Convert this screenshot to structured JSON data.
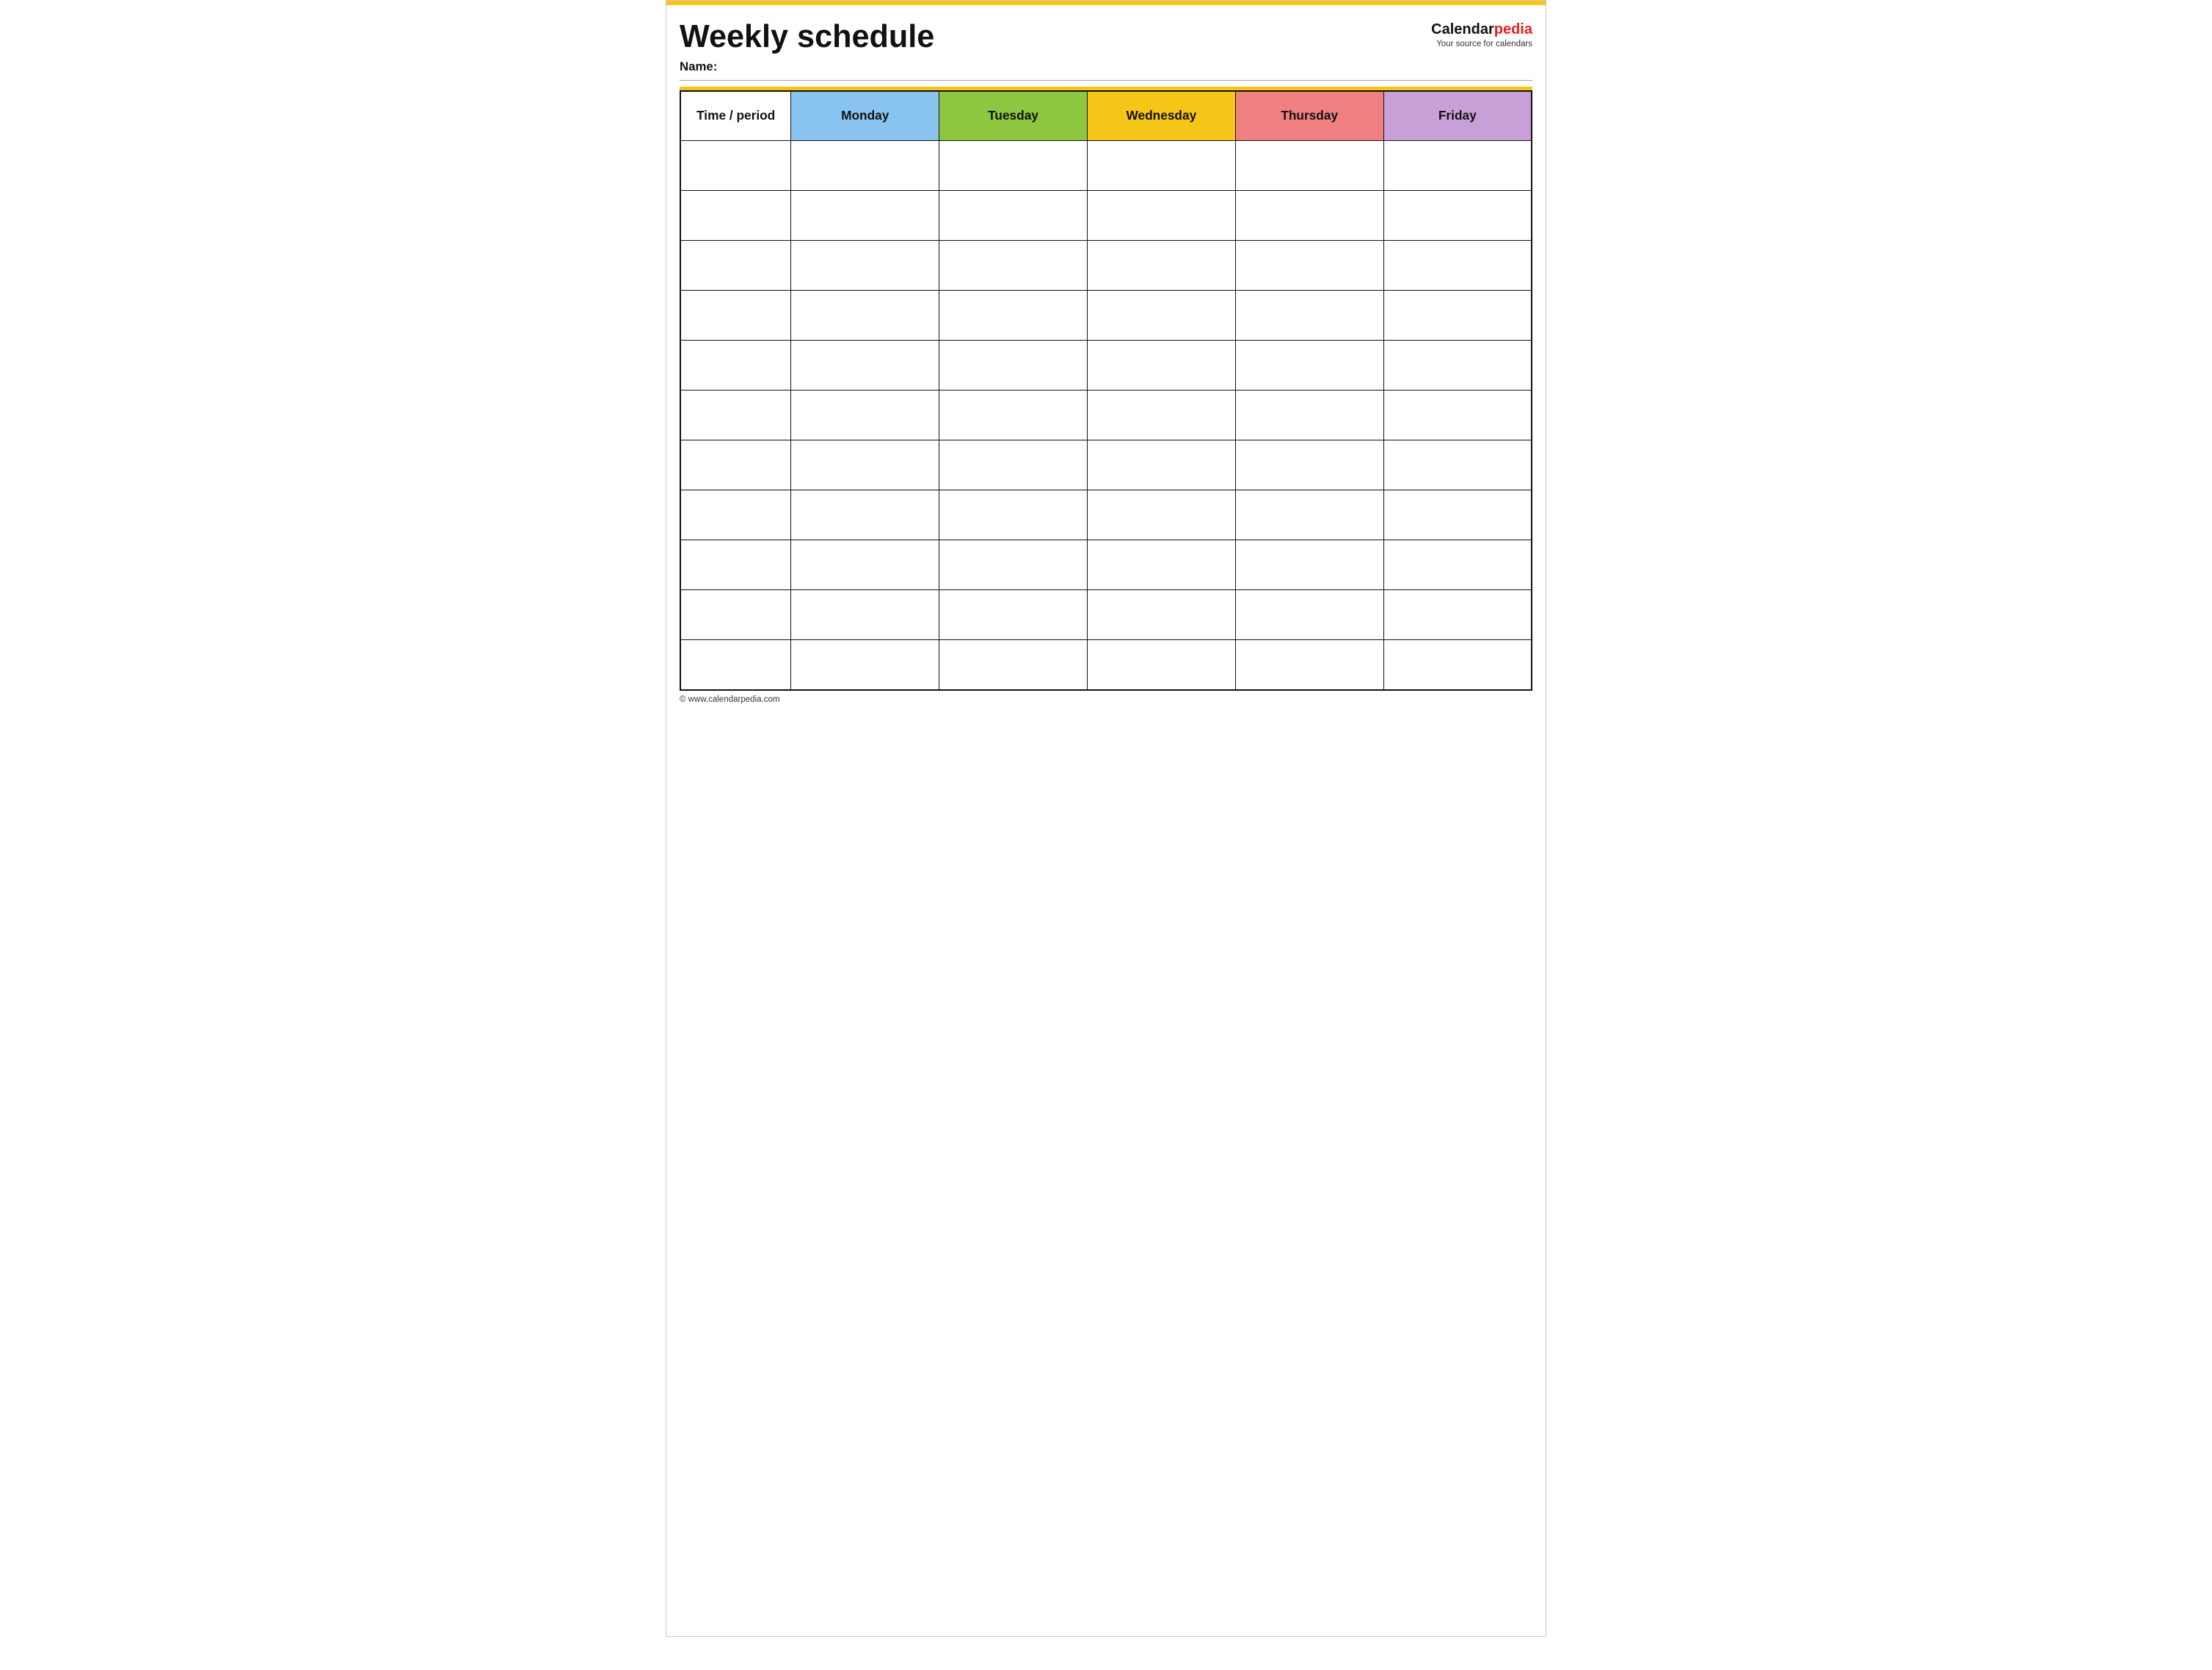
{
  "page": {
    "title": "Weekly schedule",
    "name_label": "Name:",
    "top_accent_color": "#f5c518"
  },
  "brand": {
    "name_part1": "Calendar",
    "name_part2": "pedia",
    "tagline": "Your source for calendars"
  },
  "table": {
    "columns": [
      {
        "id": "time",
        "label": "Time / period",
        "color": "#ffffff"
      },
      {
        "id": "monday",
        "label": "Monday",
        "color": "#89c4f0"
      },
      {
        "id": "tuesday",
        "label": "Tuesday",
        "color": "#8dc63f"
      },
      {
        "id": "wednesday",
        "label": "Wednesday",
        "color": "#f5c518"
      },
      {
        "id": "thursday",
        "label": "Thursday",
        "color": "#f08080"
      },
      {
        "id": "friday",
        "label": "Friday",
        "color": "#c8a0d8"
      }
    ],
    "row_count": 11
  },
  "footer": {
    "url": "© www.calendarpedia.com"
  }
}
